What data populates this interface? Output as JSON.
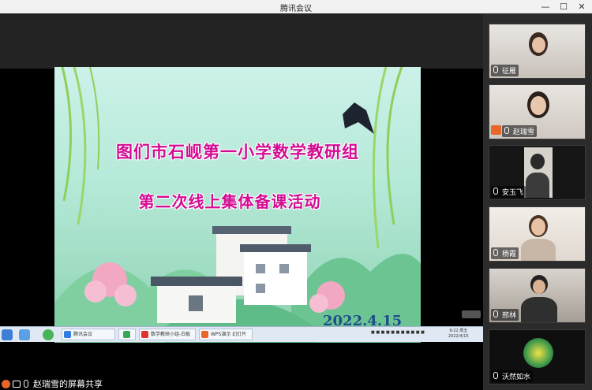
{
  "window": {
    "title": "腾讯会议",
    "controls": {
      "minimize": "—",
      "maximize": "☐",
      "close": "✕"
    }
  },
  "slide": {
    "title_line1": "图们市石岘第一小学数学教研组",
    "title_line2": "第二次线上集体备课活动",
    "date": "2022.4.15"
  },
  "taskbar": {
    "items": [
      {
        "label": "腾讯会议",
        "color": "#2f7de1"
      },
      {
        "label": "",
        "color": "#3aa757"
      },
      {
        "label": "数学教研小组-白板",
        "color": "#e0342b"
      },
      {
        "label": "WPS演示 幻灯片",
        "color": "#e9652a"
      }
    ],
    "clock_time": "9:22 周五",
    "clock_date": "2022/4/15"
  },
  "share_label": "赵瑞雪的屏幕共享",
  "participants": [
    {
      "name": "征雁",
      "bg": "#cfcac4"
    },
    {
      "name": "赵瑞雪",
      "bg": "#d8d3cf",
      "host": true
    },
    {
      "name": "安玉飞",
      "bg": "#1c1c1c"
    },
    {
      "name": "杨霞",
      "bg": "#e6e0da"
    },
    {
      "name": "邢林",
      "bg": "#b8b2ab"
    },
    {
      "name": "沃然如水",
      "bg": "#111111"
    }
  ],
  "colors": {
    "slide_title": "#d40b93",
    "date": "#1f4d88",
    "accent_orange": "#e9652a"
  }
}
